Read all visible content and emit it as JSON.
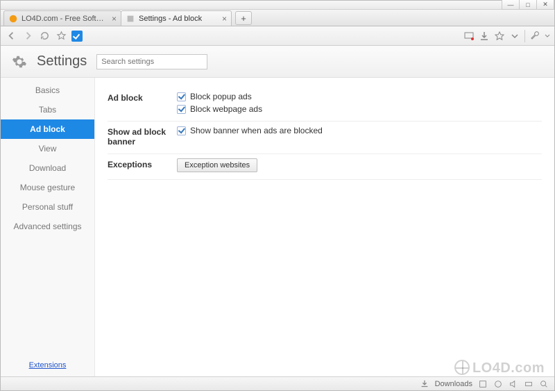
{
  "window": {
    "tabs": [
      {
        "title": "LO4D.com - Free Software",
        "active": false,
        "favicon_color": "#f39c12"
      },
      {
        "title": "Settings - Ad block",
        "active": true,
        "favicon_color": "#888"
      }
    ]
  },
  "settings": {
    "title": "Settings",
    "search_placeholder": "Search settings",
    "sidebar": [
      {
        "id": "basics",
        "label": "Basics",
        "active": false
      },
      {
        "id": "tabs",
        "label": "Tabs",
        "active": false
      },
      {
        "id": "adblock",
        "label": "Ad block",
        "active": true
      },
      {
        "id": "view",
        "label": "View",
        "active": false
      },
      {
        "id": "download",
        "label": "Download",
        "active": false
      },
      {
        "id": "mouse",
        "label": "Mouse gesture",
        "active": false
      },
      {
        "id": "personal",
        "label": "Personal stuff",
        "active": false
      },
      {
        "id": "advanced",
        "label": "Advanced settings",
        "active": false
      }
    ],
    "extensions_link": "Extensions",
    "sections": {
      "adblock": {
        "label": "Ad block",
        "options": [
          {
            "label": "Block popup ads",
            "checked": true
          },
          {
            "label": "Block webpage ads",
            "checked": true
          }
        ]
      },
      "banner": {
        "label": "Show ad block banner",
        "options": [
          {
            "label": "Show banner when ads are blocked",
            "checked": true
          }
        ]
      },
      "exceptions": {
        "label": "Exceptions",
        "button": "Exception websites"
      }
    }
  },
  "statusbar": {
    "downloads_label": "Downloads"
  },
  "watermark": "LO4D.com"
}
